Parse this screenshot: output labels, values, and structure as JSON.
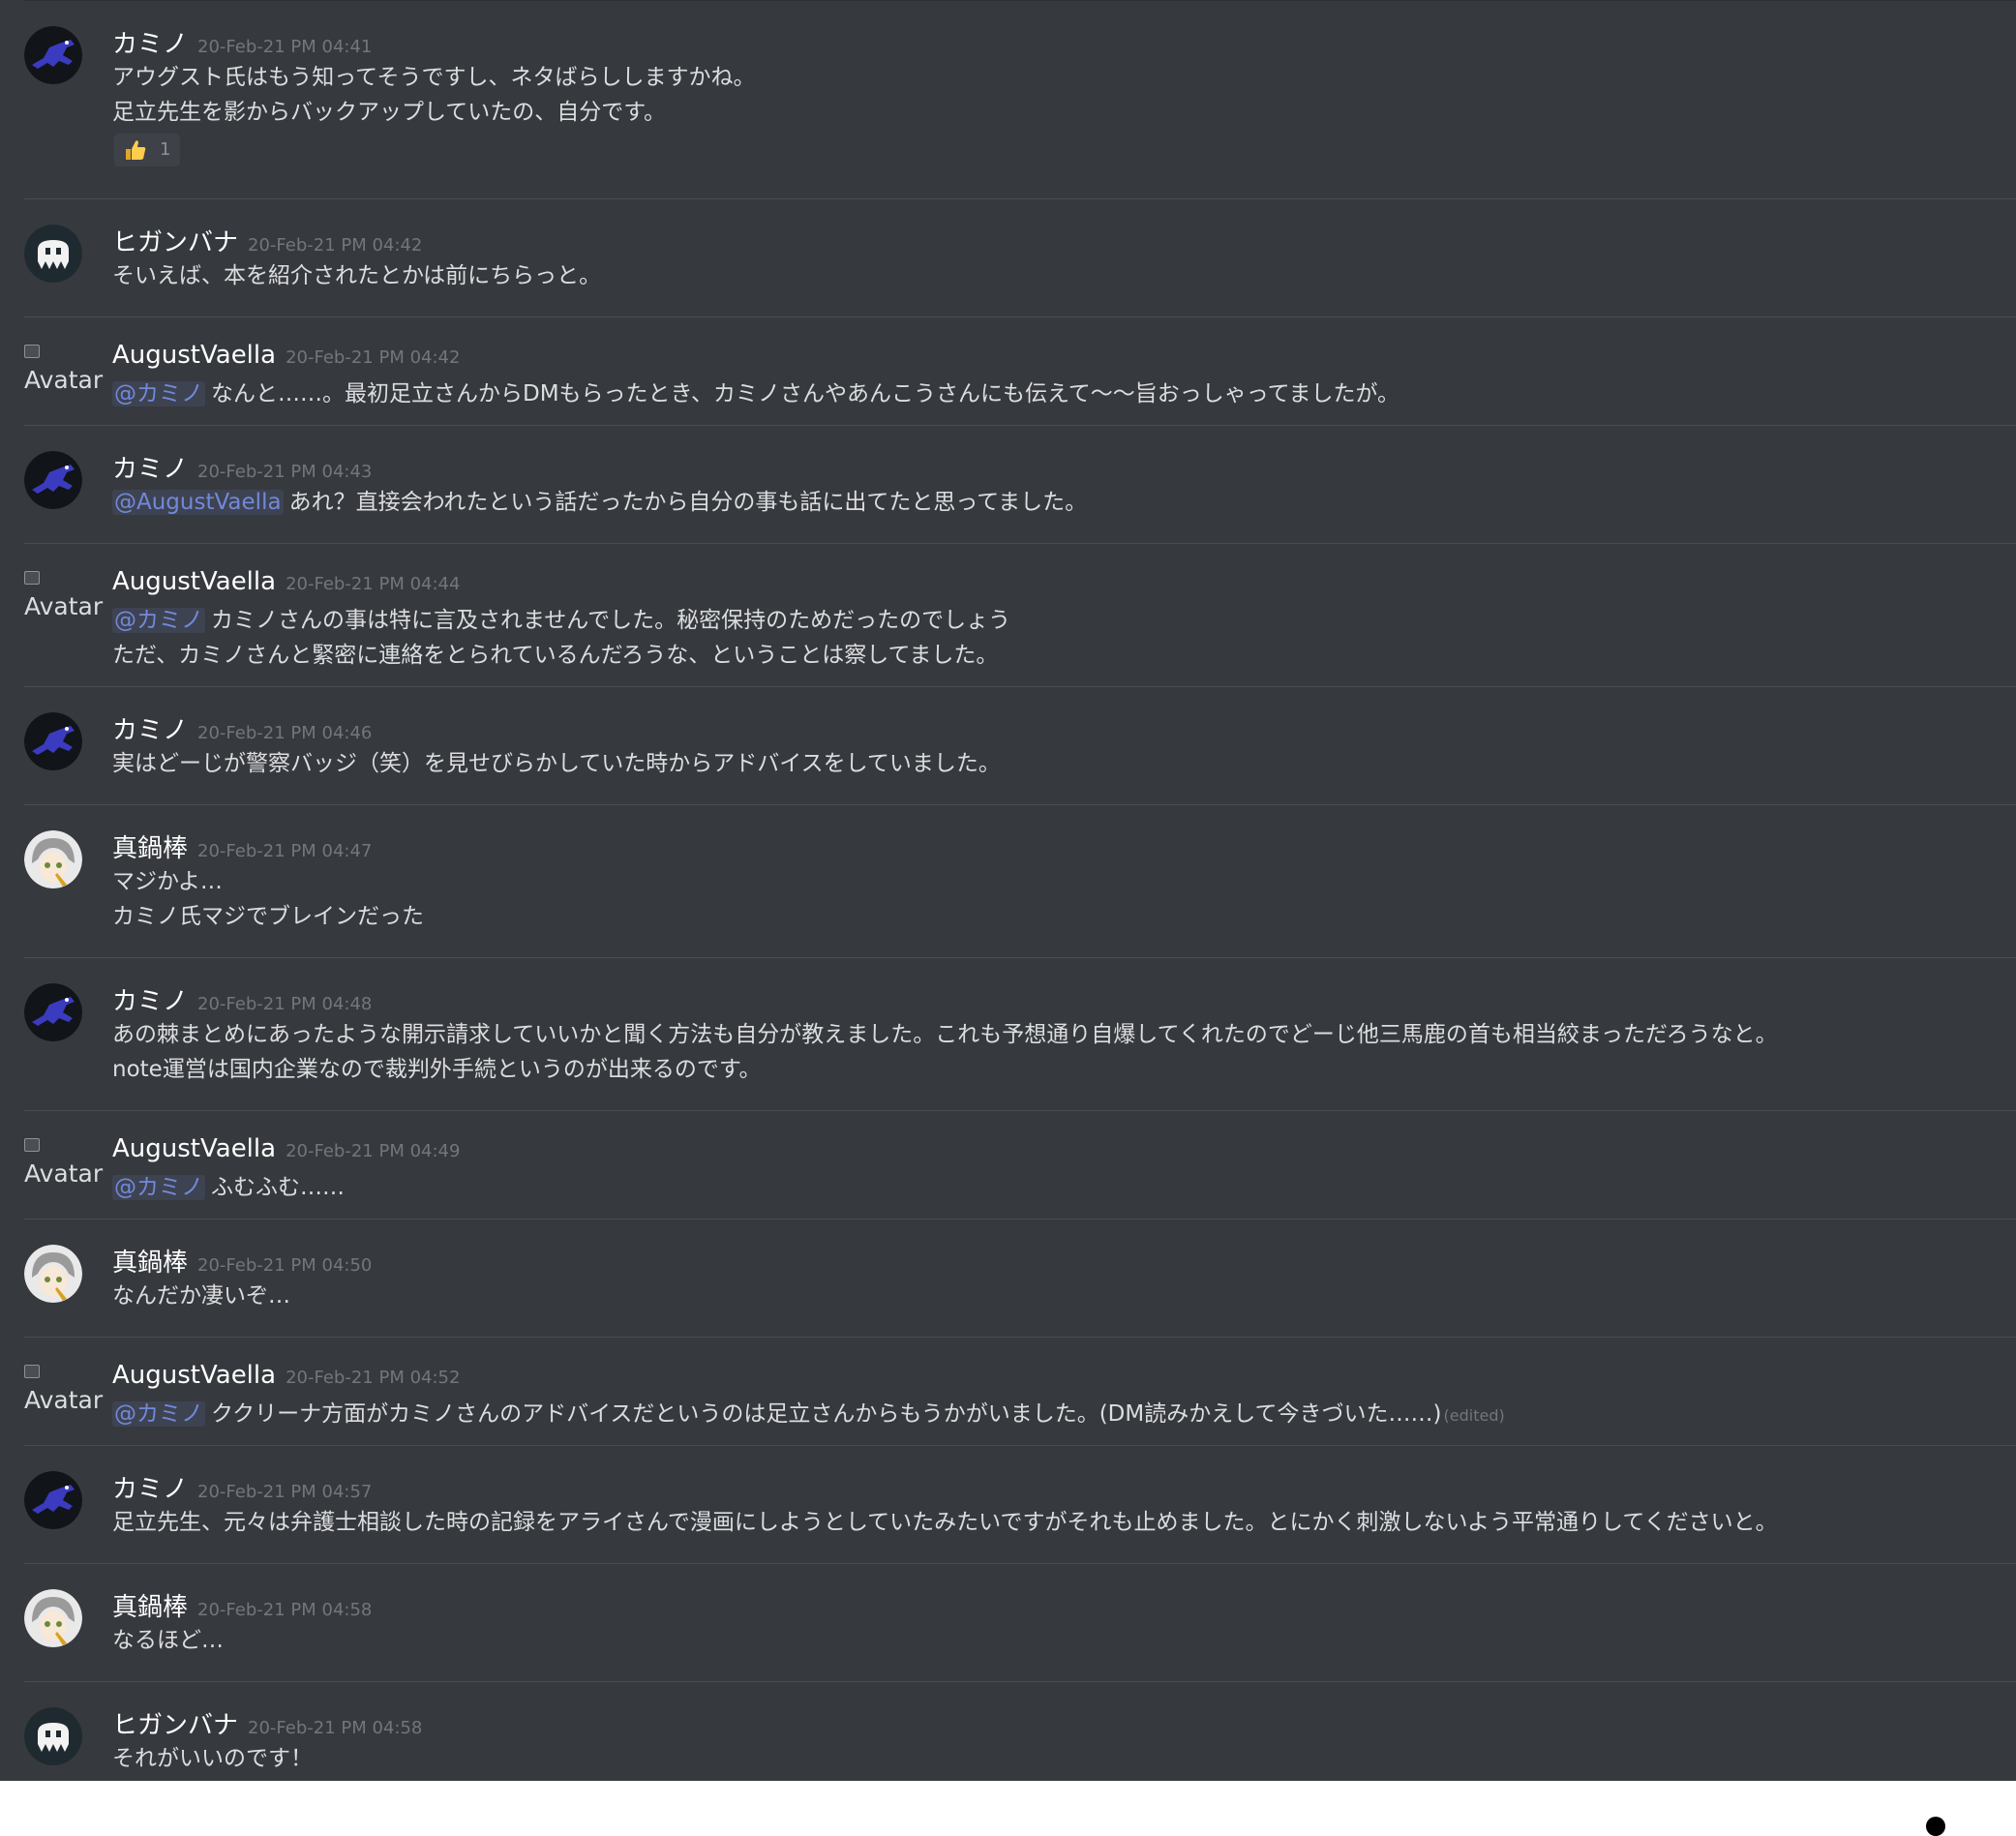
{
  "avatar_alt": "Avatar",
  "messages": [
    {
      "author": "カミノ",
      "avatar": "kamino",
      "timestamp": "20-Feb-21 PM 04:41",
      "lines": [
        {
          "text": "アウグスト氏はもう知ってそうですし、ネタばらししますかね。"
        },
        {
          "text": "足立先生を影からバックアップしていたの、自分です。"
        }
      ],
      "reaction": {
        "emoji": "thumbs-up",
        "count": "1"
      }
    },
    {
      "author": "ヒガンバナ",
      "avatar": "higanbana",
      "timestamp": "20-Feb-21 PM 04:42",
      "lines": [
        {
          "text": "そいえば、本を紹介されたとかは前にちらっと。"
        }
      ]
    },
    {
      "author": "AugustVaella",
      "avatar": "broken",
      "timestamp": "20-Feb-21 PM 04:42",
      "lines": [
        {
          "mention": "@カミノ",
          "text": "なんと……。最初足立さんからDMもらったとき、カミノさんやあんこうさんにも伝えて〜〜旨おっしゃってましたが。"
        }
      ]
    },
    {
      "author": "カミノ",
      "avatar": "kamino",
      "timestamp": "20-Feb-21 PM 04:43",
      "lines": [
        {
          "mention": "@AugustVaella",
          "text": "あれ？直接会われたという話だったから自分の事も話に出てたと思ってました。"
        }
      ]
    },
    {
      "author": "AugustVaella",
      "avatar": "broken",
      "timestamp": "20-Feb-21 PM 04:44",
      "lines": [
        {
          "mention": "@カミノ",
          "text": "カミノさんの事は特に言及されませんでした。秘密保持のためだったのでしょう"
        },
        {
          "text": "ただ、カミノさんと緊密に連絡をとられているんだろうな、ということは察してました。"
        }
      ]
    },
    {
      "author": "カミノ",
      "avatar": "kamino",
      "timestamp": "20-Feb-21 PM 04:46",
      "lines": [
        {
          "text": "実はどーじが警察バッジ（笑）を見せびらかしていた時からアドバイスをしていました。"
        }
      ]
    },
    {
      "author": "真鍋棒",
      "avatar": "manabe",
      "timestamp": "20-Feb-21 PM 04:47",
      "lines": [
        {
          "text": "マジかよ…"
        },
        {
          "text": "カミノ氏マジでブレインだった"
        }
      ]
    },
    {
      "author": "カミノ",
      "avatar": "kamino",
      "timestamp": "20-Feb-21 PM 04:48",
      "lines": [
        {
          "text": "あの棘まとめにあったような開示請求していいかと聞く方法も自分が教えました。これも予想通り自爆してくれたのでどーじ他三馬鹿の首も相当絞まっただろうなと。"
        },
        {
          "text": "note運営は国内企業なので裁判外手続というのが出来るのです。"
        }
      ]
    },
    {
      "author": "AugustVaella",
      "avatar": "broken",
      "timestamp": "20-Feb-21 PM 04:49",
      "lines": [
        {
          "mention": "@カミノ",
          "text": "ふむふむ……"
        }
      ]
    },
    {
      "author": "真鍋棒",
      "avatar": "manabe",
      "timestamp": "20-Feb-21 PM 04:50",
      "lines": [
        {
          "text": "なんだか凄いぞ…"
        }
      ]
    },
    {
      "author": "AugustVaella",
      "avatar": "broken",
      "timestamp": "20-Feb-21 PM 04:52",
      "lines": [
        {
          "mention": "@カミノ",
          "text": "ククリーナ方面がカミノさんのアドバイスだというのは足立さんからもうかがいました。(DM読みかえして今きづいた……)",
          "edited": "(edited)"
        }
      ]
    },
    {
      "author": "カミノ",
      "avatar": "kamino",
      "timestamp": "20-Feb-21 PM 04:57",
      "lines": [
        {
          "text": "足立先生、元々は弁護士相談した時の記録をアライさんで漫画にしようとしていたみたいですがそれも止めました。とにかく刺激しないよう平常通りしてくださいと。"
        }
      ]
    },
    {
      "author": "真鍋棒",
      "avatar": "manabe",
      "timestamp": "20-Feb-21 PM 04:58",
      "lines": [
        {
          "text": "なるほど…"
        }
      ]
    },
    {
      "author": "ヒガンバナ",
      "avatar": "higanbana",
      "timestamp": "20-Feb-21 PM 04:58",
      "lines": [
        {
          "text": "それがいいのです！"
        }
      ]
    }
  ]
}
